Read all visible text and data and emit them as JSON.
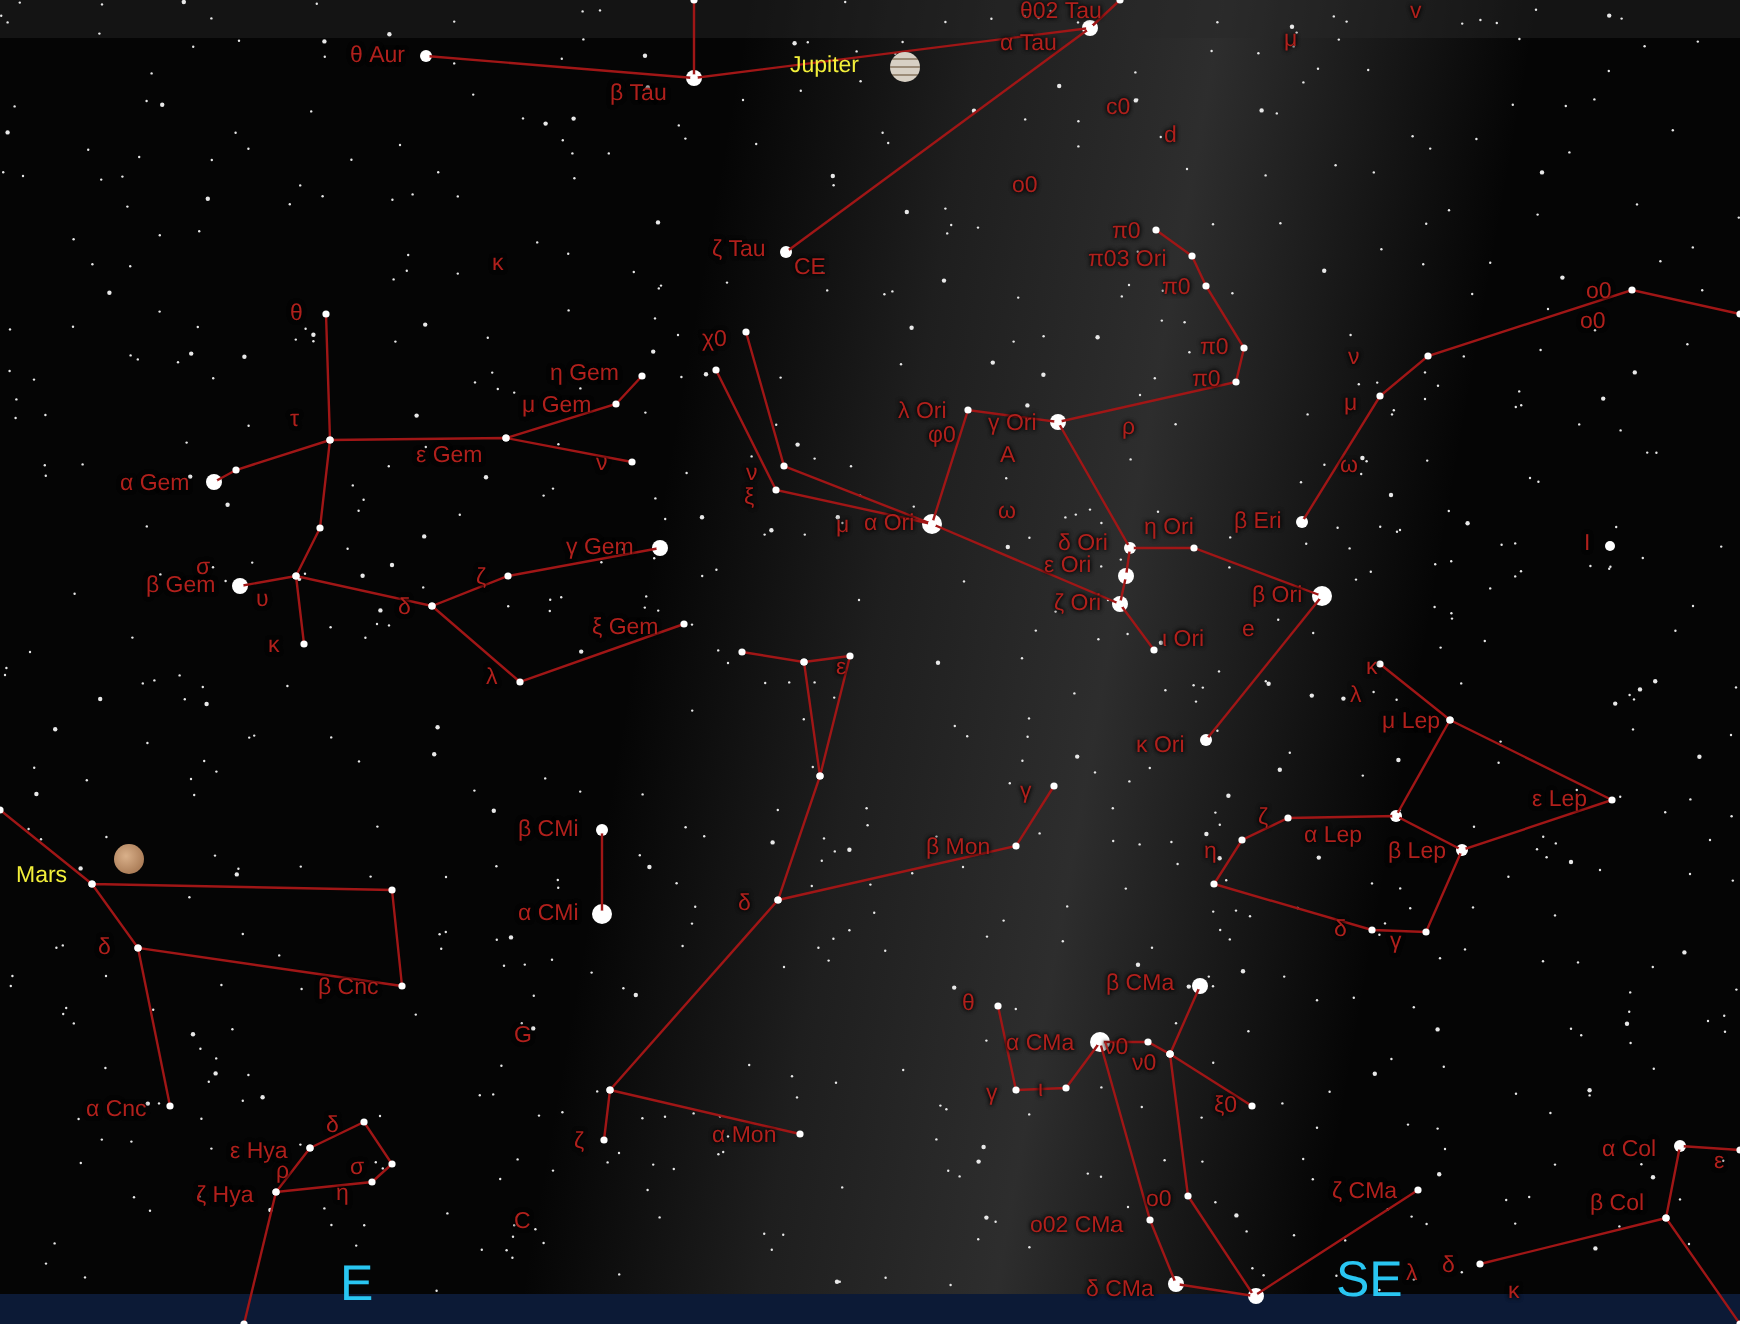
{
  "planets": [
    {
      "name": "Jupiter"
    },
    {
      "name": "Mars"
    }
  ],
  "star_labels": [
    "θ Aur",
    "β Tau",
    "θ02 Tau",
    "α Tau",
    "μ",
    "v",
    "c0",
    "d",
    "o0",
    "κ",
    "ζ Tau",
    "CE",
    "π0",
    "π03 Ori",
    "π0",
    "π0",
    "π0",
    "o0",
    "o0",
    "θ",
    "χ0",
    "η Gem",
    "μ Gem",
    "ε Gem",
    "τ",
    "ν",
    "α Gem",
    "ν",
    "μ",
    "ω",
    "λ Ori",
    "φ0",
    "γ Ori",
    "A",
    "ρ",
    "ν",
    "ξ",
    "μ",
    "α Ori",
    "ω",
    "γ Gem",
    "δ Ori",
    "η Ori",
    "β Eri",
    "I",
    "ε Ori",
    "ζ Ori",
    "β Ori",
    "ι Ori",
    "e",
    "σ",
    "β Gem",
    "υ",
    "ζ",
    "δ",
    "ξ Gem",
    "κ",
    "λ",
    "ε",
    "κ",
    "λ",
    "μ Lep",
    "κ Ori",
    "γ",
    "β Mon",
    "ζ",
    "α Lep",
    "η",
    "ε Lep",
    "β Lep",
    "β CMi",
    "α CMi",
    "δ",
    "δ",
    "β Cnc",
    "δ",
    "γ",
    "β CMa",
    "θ",
    "α CMa",
    "ν0",
    "ν0",
    "γ",
    "ι",
    "ξ0",
    "G",
    "α Cnc",
    "ζ",
    "α Mon",
    "δ",
    "ε Hya",
    "ρ",
    "σ",
    "ζ Hya",
    "η",
    "ζ CMa",
    "α Col",
    "ε",
    "ο0",
    "o02 CMa",
    "β Col",
    "δ",
    "κ",
    "λ",
    "C",
    "δ CMa"
  ],
  "cardinal_points": [
    "E",
    "SE"
  ]
}
